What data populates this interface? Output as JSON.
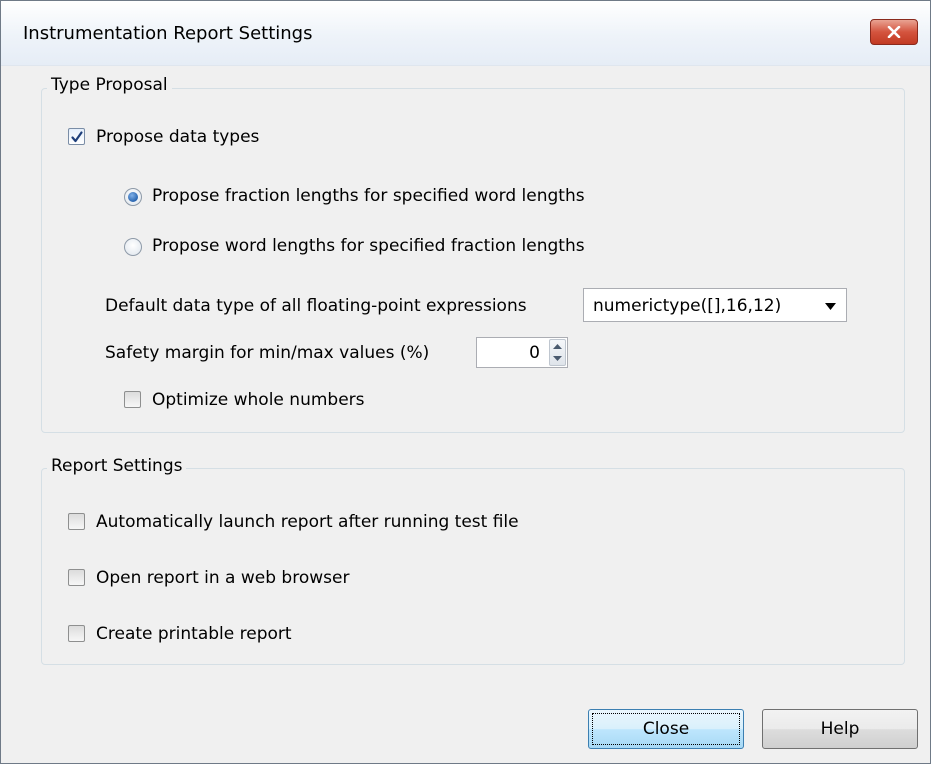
{
  "window": {
    "title": "Instrumentation Report Settings",
    "close_icon": "close-x-icon"
  },
  "type_proposal": {
    "group_label": "Type Proposal",
    "propose_data_types": {
      "label": "Propose data types",
      "checked": true
    },
    "radio_fraction": {
      "label": "Propose fraction lengths for specified word lengths",
      "selected": true
    },
    "radio_word": {
      "label": "Propose word lengths for specified fraction lengths",
      "selected": false
    },
    "default_type": {
      "label": "Default data type of all floating-point expressions",
      "value": "numerictype([],16,12)"
    },
    "safety_margin": {
      "label": "Safety margin for min/max values (%)",
      "value": "0"
    },
    "optimize_whole_numbers": {
      "label": "Optimize whole numbers",
      "checked": false
    }
  },
  "report_settings": {
    "group_label": "Report Settings",
    "auto_launch": {
      "label": "Automatically launch report after running test file",
      "checked": false
    },
    "open_in_browser": {
      "label": "Open report in a web browser",
      "checked": false
    },
    "printable": {
      "label": "Create printable report",
      "checked": false
    }
  },
  "buttons": {
    "close": "Close",
    "help": "Help"
  },
  "colors": {
    "close_button_red": "#c23a23",
    "selected_accent": "#1c5aa8",
    "dialog_background": "#f0f0f0"
  }
}
